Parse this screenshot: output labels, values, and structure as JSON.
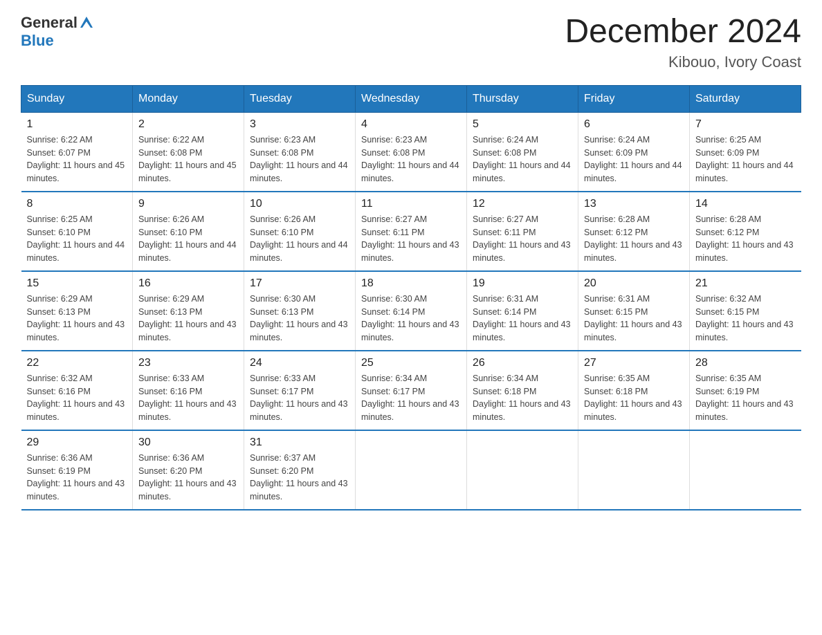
{
  "header": {
    "logo_general": "General",
    "logo_blue": "Blue",
    "month_title": "December 2024",
    "location": "Kibouo, Ivory Coast"
  },
  "weekdays": [
    "Sunday",
    "Monday",
    "Tuesday",
    "Wednesday",
    "Thursday",
    "Friday",
    "Saturday"
  ],
  "weeks": [
    [
      {
        "day": "1",
        "sunrise": "6:22 AM",
        "sunset": "6:07 PM",
        "daylight": "11 hours and 45 minutes."
      },
      {
        "day": "2",
        "sunrise": "6:22 AM",
        "sunset": "6:08 PM",
        "daylight": "11 hours and 45 minutes."
      },
      {
        "day": "3",
        "sunrise": "6:23 AM",
        "sunset": "6:08 PM",
        "daylight": "11 hours and 44 minutes."
      },
      {
        "day": "4",
        "sunrise": "6:23 AM",
        "sunset": "6:08 PM",
        "daylight": "11 hours and 44 minutes."
      },
      {
        "day": "5",
        "sunrise": "6:24 AM",
        "sunset": "6:08 PM",
        "daylight": "11 hours and 44 minutes."
      },
      {
        "day": "6",
        "sunrise": "6:24 AM",
        "sunset": "6:09 PM",
        "daylight": "11 hours and 44 minutes."
      },
      {
        "day": "7",
        "sunrise": "6:25 AM",
        "sunset": "6:09 PM",
        "daylight": "11 hours and 44 minutes."
      }
    ],
    [
      {
        "day": "8",
        "sunrise": "6:25 AM",
        "sunset": "6:10 PM",
        "daylight": "11 hours and 44 minutes."
      },
      {
        "day": "9",
        "sunrise": "6:26 AM",
        "sunset": "6:10 PM",
        "daylight": "11 hours and 44 minutes."
      },
      {
        "day": "10",
        "sunrise": "6:26 AM",
        "sunset": "6:10 PM",
        "daylight": "11 hours and 44 minutes."
      },
      {
        "day": "11",
        "sunrise": "6:27 AM",
        "sunset": "6:11 PM",
        "daylight": "11 hours and 43 minutes."
      },
      {
        "day": "12",
        "sunrise": "6:27 AM",
        "sunset": "6:11 PM",
        "daylight": "11 hours and 43 minutes."
      },
      {
        "day": "13",
        "sunrise": "6:28 AM",
        "sunset": "6:12 PM",
        "daylight": "11 hours and 43 minutes."
      },
      {
        "day": "14",
        "sunrise": "6:28 AM",
        "sunset": "6:12 PM",
        "daylight": "11 hours and 43 minutes."
      }
    ],
    [
      {
        "day": "15",
        "sunrise": "6:29 AM",
        "sunset": "6:13 PM",
        "daylight": "11 hours and 43 minutes."
      },
      {
        "day": "16",
        "sunrise": "6:29 AM",
        "sunset": "6:13 PM",
        "daylight": "11 hours and 43 minutes."
      },
      {
        "day": "17",
        "sunrise": "6:30 AM",
        "sunset": "6:13 PM",
        "daylight": "11 hours and 43 minutes."
      },
      {
        "day": "18",
        "sunrise": "6:30 AM",
        "sunset": "6:14 PM",
        "daylight": "11 hours and 43 minutes."
      },
      {
        "day": "19",
        "sunrise": "6:31 AM",
        "sunset": "6:14 PM",
        "daylight": "11 hours and 43 minutes."
      },
      {
        "day": "20",
        "sunrise": "6:31 AM",
        "sunset": "6:15 PM",
        "daylight": "11 hours and 43 minutes."
      },
      {
        "day": "21",
        "sunrise": "6:32 AM",
        "sunset": "6:15 PM",
        "daylight": "11 hours and 43 minutes."
      }
    ],
    [
      {
        "day": "22",
        "sunrise": "6:32 AM",
        "sunset": "6:16 PM",
        "daylight": "11 hours and 43 minutes."
      },
      {
        "day": "23",
        "sunrise": "6:33 AM",
        "sunset": "6:16 PM",
        "daylight": "11 hours and 43 minutes."
      },
      {
        "day": "24",
        "sunrise": "6:33 AM",
        "sunset": "6:17 PM",
        "daylight": "11 hours and 43 minutes."
      },
      {
        "day": "25",
        "sunrise": "6:34 AM",
        "sunset": "6:17 PM",
        "daylight": "11 hours and 43 minutes."
      },
      {
        "day": "26",
        "sunrise": "6:34 AM",
        "sunset": "6:18 PM",
        "daylight": "11 hours and 43 minutes."
      },
      {
        "day": "27",
        "sunrise": "6:35 AM",
        "sunset": "6:18 PM",
        "daylight": "11 hours and 43 minutes."
      },
      {
        "day": "28",
        "sunrise": "6:35 AM",
        "sunset": "6:19 PM",
        "daylight": "11 hours and 43 minutes."
      }
    ],
    [
      {
        "day": "29",
        "sunrise": "6:36 AM",
        "sunset": "6:19 PM",
        "daylight": "11 hours and 43 minutes."
      },
      {
        "day": "30",
        "sunrise": "6:36 AM",
        "sunset": "6:20 PM",
        "daylight": "11 hours and 43 minutes."
      },
      {
        "day": "31",
        "sunrise": "6:37 AM",
        "sunset": "6:20 PM",
        "daylight": "11 hours and 43 minutes."
      },
      null,
      null,
      null,
      null
    ]
  ]
}
